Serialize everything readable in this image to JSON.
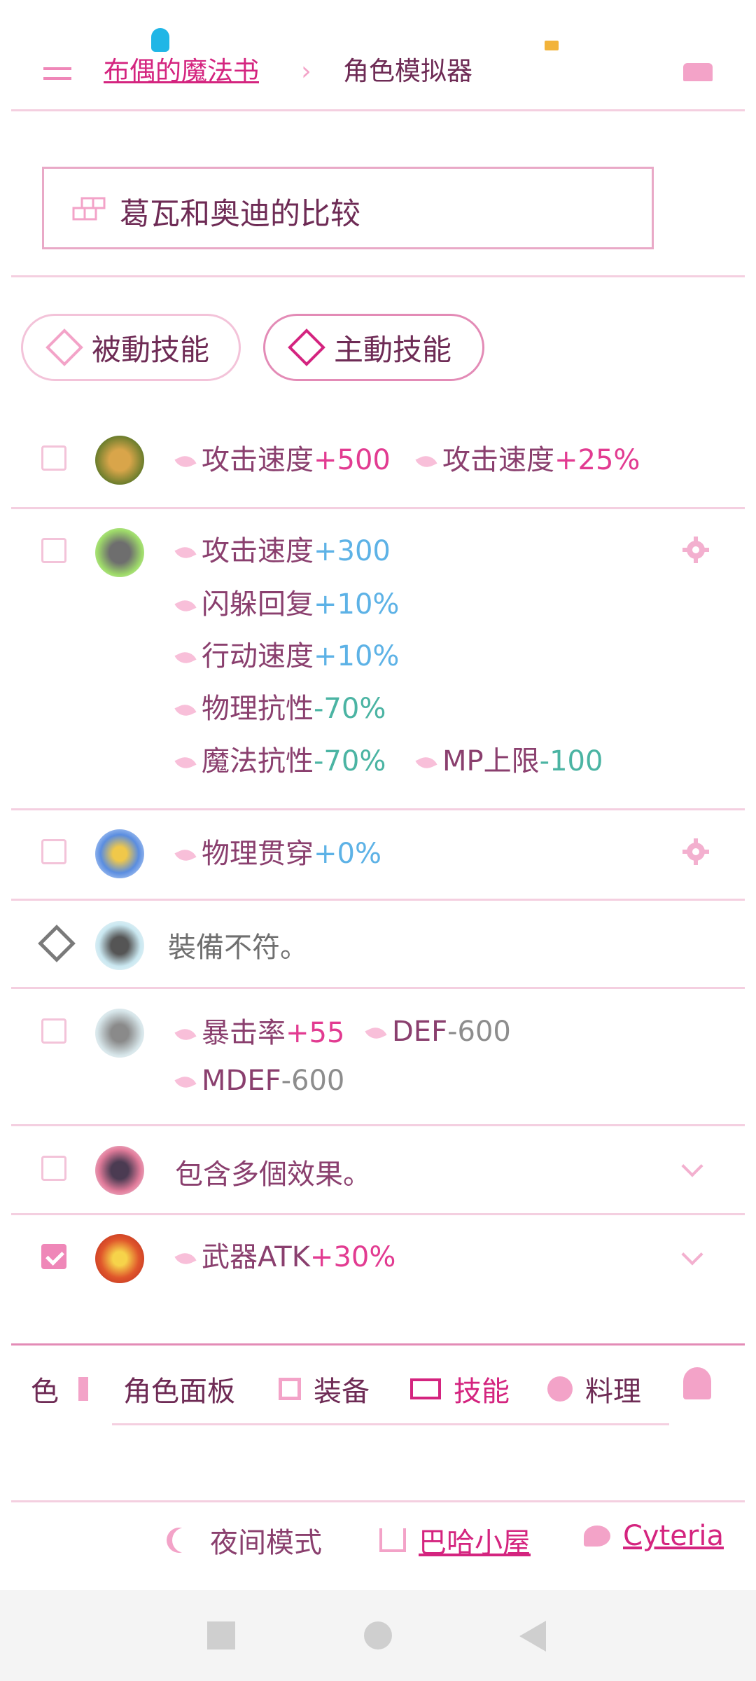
{
  "header": {
    "breadcrumb_link": "布偶的魔法书",
    "breadcrumb_separator": "›",
    "breadcrumb_current": "角色模拟器"
  },
  "search": {
    "label": "葛瓦和奥迪的比较"
  },
  "tabs": [
    {
      "label": "被動技能",
      "active": false
    },
    {
      "label": "主動技能",
      "active": true
    }
  ],
  "skills": [
    {
      "checked": false,
      "effects": [
        {
          "name": "攻击速度",
          "value": "+500"
        },
        {
          "name": "攻击速度",
          "value": "+25%"
        }
      ]
    },
    {
      "checked": false,
      "effects": [
        {
          "name": "攻击速度",
          "value": "+300"
        },
        {
          "name": "闪躲回复",
          "value": "+10%"
        },
        {
          "name": "行动速度",
          "value": "+10%"
        },
        {
          "name": "物理抗性",
          "value": "-70%"
        },
        {
          "name": "魔法抗性",
          "value": "-70%"
        },
        {
          "name": "MP上限",
          "value": "-100"
        }
      ]
    },
    {
      "checked": false,
      "effects": [
        {
          "name": "物理贯穿",
          "value": "+0%"
        }
      ]
    },
    {
      "marker": "diamond",
      "text": "裝備不符。"
    },
    {
      "checked": false,
      "effects": [
        {
          "name": "暴击率",
          "value": "+55"
        },
        {
          "name": "DEF",
          "value": "-600"
        },
        {
          "name": "MDEF",
          "value": "-600"
        }
      ]
    },
    {
      "checked": false,
      "text": "包含多個效果。"
    },
    {
      "checked": true,
      "effects": [
        {
          "name": "武器ATK",
          "value": "+30%"
        }
      ]
    }
  ],
  "bottom_nav": [
    {
      "label": "色"
    },
    {
      "label": "角色面板",
      "icon": "character-panel-icon"
    },
    {
      "label": "装备",
      "icon": "equipment-icon"
    },
    {
      "label": "技能",
      "icon": "skill-icon",
      "active": true
    },
    {
      "label": "料理",
      "icon": "apple-icon"
    }
  ],
  "footer": {
    "night_mode": "夜间模式",
    "home": "巴哈小屋",
    "twitter": "Cyteria"
  },
  "colors": {
    "accent": "#d4247f",
    "border": "#f4cfe0"
  }
}
